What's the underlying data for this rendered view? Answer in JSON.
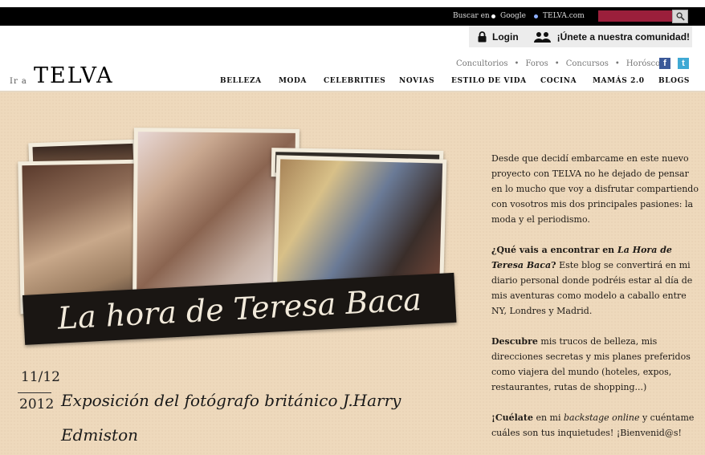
{
  "topbar": {
    "search_label": "Buscar en",
    "option_google": "Google",
    "option_telva": "TELVA.com",
    "search_value": ""
  },
  "loginbar": {
    "login": "Login",
    "join": "¡Únete a nuestra comunidad!"
  },
  "header": {
    "ira": "Ir a",
    "logo": "TELVA",
    "secondary_nav": [
      "Concultorios",
      "Foros",
      "Concursos",
      "Horóscopo"
    ],
    "social_fb": "f",
    "social_tw": "t",
    "main_nav": [
      "BELLEZA",
      "MODA",
      "CELEBRITIES",
      "NOVIAS",
      "ESTILO DE VIDA",
      "COCINA",
      "MAMÁS 2.0",
      "BLOGS"
    ]
  },
  "banner": {
    "title": "La hora de Teresa Baca"
  },
  "post": {
    "date_top": "11/12",
    "date_bottom": "2012",
    "title": "Exposición del fotógrafo británico J.Harry Edmiston"
  },
  "about": {
    "p1": "Desde que decidí embarcame en este nuevo proyecto con TELVA no he dejado de pensar en lo mucho que voy a disfrutar compartiendo con vosotros mis dos principales pasiones: la moda y el periodismo.",
    "p2_bold": "¿Qué vais a encontrar en ",
    "p2_bolditalic": "La Hora de Teresa Baca",
    "p2_bold2": "?",
    "p2_rest": " Este blog se convertirá en mi diario personal donde podréis estar al día de mis aventuras como modelo a caballo entre NY, Londres y Madrid.",
    "p3_bold": "Descubre",
    "p3_rest": " mis trucos de belleza, mis direcciones secretas y mis planes preferidos como viajera del mundo (hoteles, expos, restaurantes, rutas de shopping...)",
    "p4_bold": "¡Cuélate",
    "p4_mid": " en mi ",
    "p4_italic": "backstage online",
    "p4_rest": " y cuéntame cuáles son tus inquietudes! ¡Bienvenid@s!"
  },
  "colors": {
    "accent": "#9b1f3b",
    "background": "#eed9bc"
  }
}
